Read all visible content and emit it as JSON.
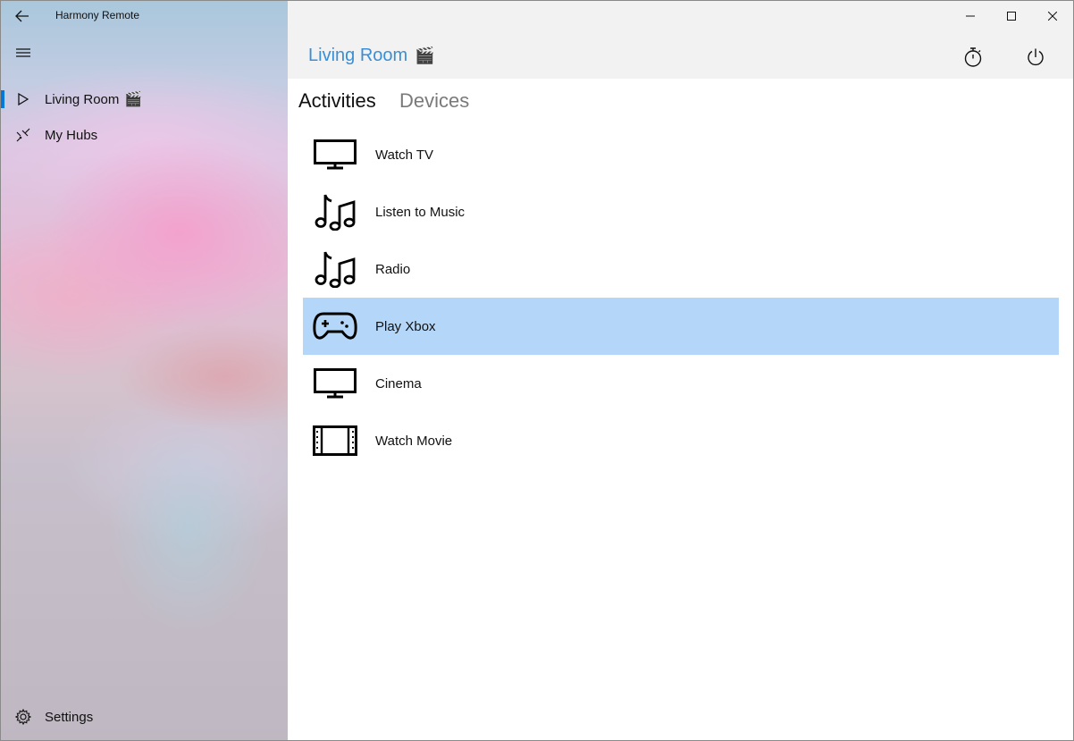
{
  "app": {
    "title": "Harmony Remote"
  },
  "sidebar": {
    "items": [
      {
        "label": "Living Room",
        "suffix": "🎬",
        "icon": "play-outline-icon",
        "selected": true
      },
      {
        "label": "My Hubs",
        "icon": "hubs-icon",
        "selected": false
      }
    ],
    "settings_label": "Settings"
  },
  "header": {
    "room_title": "Living Room",
    "room_suffix": "🎬"
  },
  "tabs": [
    {
      "label": "Activities",
      "active": true
    },
    {
      "label": "Devices",
      "active": false
    }
  ],
  "activities": [
    {
      "label": "Watch TV",
      "icon": "tv-icon",
      "selected": false
    },
    {
      "label": "Listen to Music",
      "icon": "music-icon",
      "selected": false
    },
    {
      "label": "Radio",
      "icon": "music-icon",
      "selected": false
    },
    {
      "label": "Play Xbox",
      "icon": "gamepad-icon",
      "selected": true
    },
    {
      "label": "Cinema",
      "icon": "tv-icon",
      "selected": false
    },
    {
      "label": "Watch Movie",
      "icon": "film-icon",
      "selected": false
    }
  ],
  "colors": {
    "accent": "#0078d7",
    "room_title": "#3a8ed6",
    "selected_row": "#b4d6f8",
    "header_band": "#f2f2f2"
  }
}
